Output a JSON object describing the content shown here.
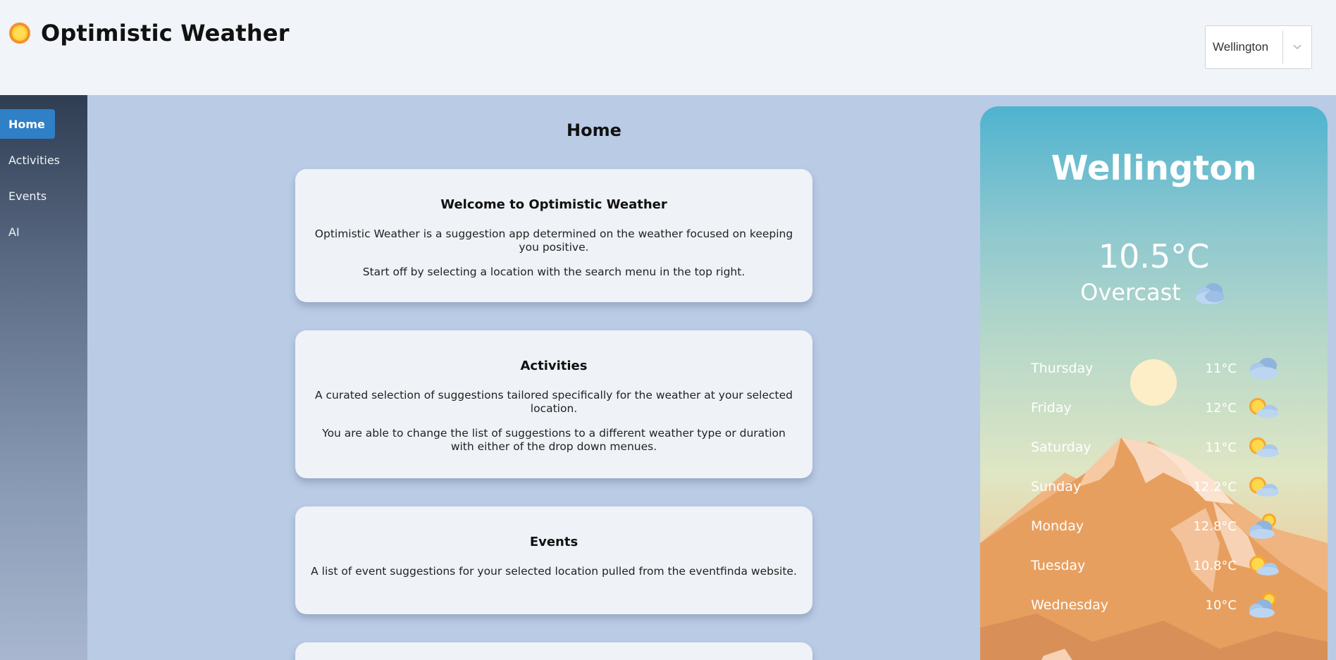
{
  "app": {
    "title": "Optimistic Weather",
    "logo_icon": "sun-icon"
  },
  "location_select": {
    "value": "Wellington"
  },
  "sidebar": {
    "items": [
      {
        "label": "Home",
        "active": true
      },
      {
        "label": "Activities",
        "active": false
      },
      {
        "label": "Events",
        "active": false
      },
      {
        "label": "AI",
        "active": false
      }
    ]
  },
  "main": {
    "page_title": "Home",
    "cards": [
      {
        "title": "Welcome to Optimistic Weather",
        "paragraphs": [
          "Optimistic Weather is a suggestion app determined on the weather focused on keeping you positive.",
          "Start off by selecting a location with the search menu in the top right."
        ]
      },
      {
        "title": "Activities",
        "paragraphs": [
          "A curated selection of suggestions tailored specifically for the weather at your selected location.",
          "You are able to change the list of suggestions to a different weather type or duration with either of the drop down menues."
        ]
      },
      {
        "title": "Events",
        "paragraphs": [
          "A list of event suggestions for your selected location pulled from the eventfinda website."
        ]
      }
    ]
  },
  "weather": {
    "city": "Wellington",
    "temperature": "10.5°C",
    "condition": "Overcast",
    "condition_icon": "cloud-icon",
    "forecast": [
      {
        "day": "Thursday",
        "temp": "11°C",
        "icon": "cloud-icon"
      },
      {
        "day": "Friday",
        "temp": "12°C",
        "icon": "sun-cloud-icon"
      },
      {
        "day": "Saturday",
        "temp": "11°C",
        "icon": "sun-cloud-icon"
      },
      {
        "day": "Sunday",
        "temp": "12.2°C",
        "icon": "sun-cloud-icon"
      },
      {
        "day": "Monday",
        "temp": "12.8°C",
        "icon": "cloud-sun-icon"
      },
      {
        "day": "Tuesday",
        "temp": "10.8°C",
        "icon": "sun-cloud-icon"
      },
      {
        "day": "Wednesday",
        "temp": "10°C",
        "icon": "cloud-sun-icon"
      }
    ]
  },
  "colors": {
    "accent": "#2f80c6",
    "main_bg": "#b9cbe5",
    "card_bg": "#eff2f7",
    "header_bg": "#f1f4f9"
  }
}
